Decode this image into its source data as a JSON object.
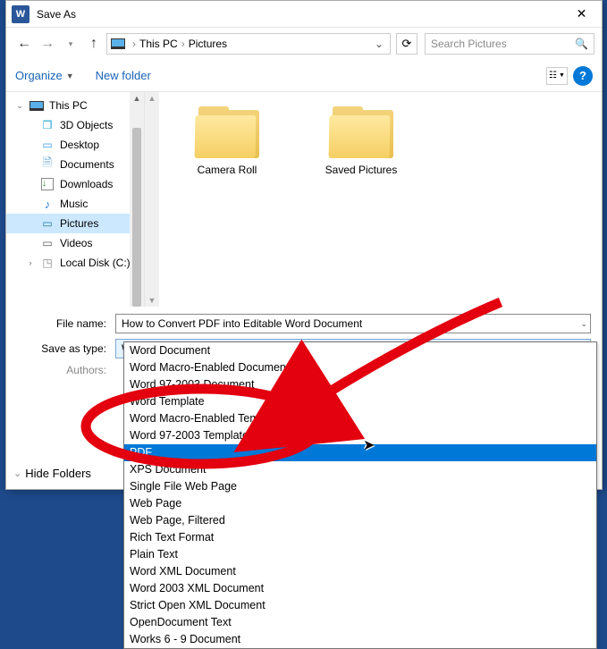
{
  "title": "Save As",
  "nav": {
    "breadcrumb1": "This PC",
    "breadcrumb2": "Pictures",
    "search_placeholder": "Search Pictures"
  },
  "toolbar": {
    "organize": "Organize",
    "new_folder": "New folder"
  },
  "tree": {
    "root": "This PC",
    "items": [
      "3D Objects",
      "Desktop",
      "Documents",
      "Downloads",
      "Music",
      "Pictures",
      "Videos",
      "Local Disk (C:)"
    ],
    "selected_index": 5
  },
  "folders": [
    "Camera Roll",
    "Saved Pictures"
  ],
  "form": {
    "filename_label": "File name:",
    "filename_value": "How to Convert PDF into Editable Word Document",
    "type_label": "Save as type:",
    "type_value": "Word Document",
    "authors_label": "Authors:"
  },
  "type_options": [
    "Word Document",
    "Word Macro-Enabled Document",
    "Word 97-2003 Document",
    "Word Template",
    "Word Macro-Enabled Template",
    "Word 97-2003 Template",
    "PDF",
    "XPS Document",
    "Single File Web Page",
    "Web Page",
    "Web Page, Filtered",
    "Rich Text Format",
    "Plain Text",
    "Word XML Document",
    "Word 2003 XML Document",
    "Strict Open XML Document",
    "OpenDocument Text",
    "Works 6 - 9 Document"
  ],
  "type_selected_index": 6,
  "footer": {
    "hide_folders": "Hide Folders"
  }
}
